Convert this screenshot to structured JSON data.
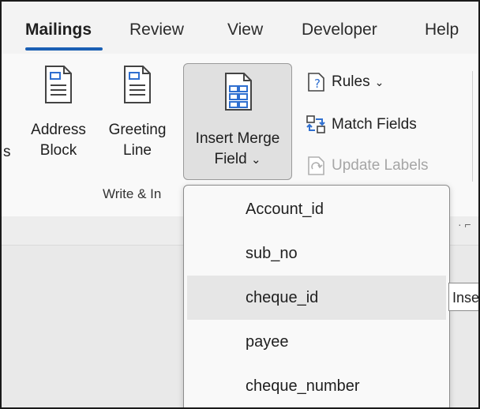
{
  "tabs": [
    {
      "label": "Mailings",
      "active": true
    },
    {
      "label": "Review",
      "active": false
    },
    {
      "label": "View",
      "active": false
    },
    {
      "label": "Developer",
      "active": false
    },
    {
      "label": "Help",
      "active": false
    }
  ],
  "ribbon": {
    "cut_off_left_text": "s",
    "address_block": {
      "line1": "Address",
      "line2": "Block",
      "icon": "document-icon"
    },
    "greeting_line": {
      "line1": "Greeting",
      "line2": "Line",
      "icon": "document-icon"
    },
    "insert_merge_field": {
      "line1": "Insert Merge",
      "line2": "Field",
      "chevron": "⌄",
      "icon": "merge-field-icon"
    },
    "rules": {
      "label": "Rules",
      "chevron": "⌄",
      "icon": "rules-icon"
    },
    "match_fields": {
      "label": "Match Fields",
      "icon": "match-fields-icon"
    },
    "update_labels": {
      "label": "Update Labels",
      "icon": "update-labels-icon",
      "disabled": true
    },
    "group_label": "Write & In"
  },
  "dropdown": {
    "items": [
      "Account_id",
      "sub_no",
      "cheque_id",
      "payee",
      "cheque_number"
    ],
    "hovered_index": 2
  },
  "tooltip": {
    "text": "Inse"
  },
  "colors": {
    "accent": "#1a5fb4",
    "icon_blue": "#2f6fd0"
  }
}
